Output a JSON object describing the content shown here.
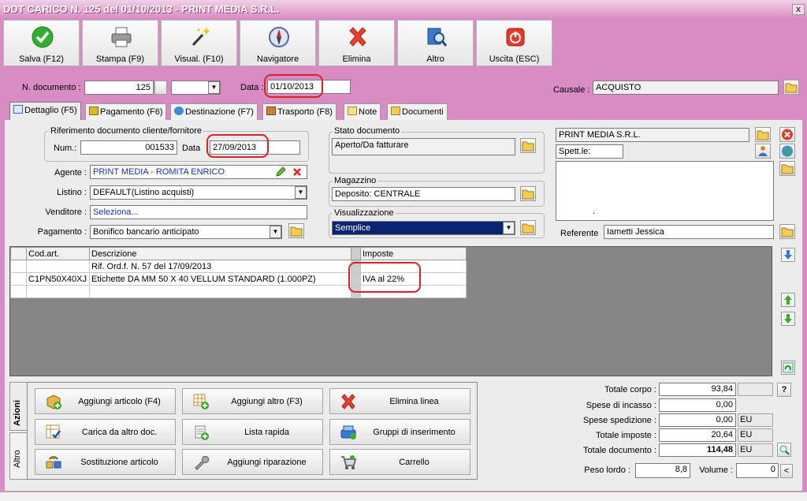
{
  "window": {
    "title": "DDT CARICO N. 125 del 01/10/2013 - PRINT MEDIA S.R.L.",
    "close": "x"
  },
  "toolbar": [
    {
      "label": "Salva (F12)",
      "icon": "check-icon"
    },
    {
      "label": "Stampa (F9)",
      "icon": "printer-icon"
    },
    {
      "label": "Visual. (F10)",
      "icon": "magic-wand-icon"
    },
    {
      "label": "Navigatore",
      "icon": "compass-icon"
    },
    {
      "label": "Elimina",
      "icon": "delete-x-icon"
    },
    {
      "label": "Altro",
      "icon": "search-doc-icon"
    },
    {
      "label": "Uscita (ESC)",
      "icon": "power-icon"
    }
  ],
  "header": {
    "num_doc_label": "N. documento :",
    "num_doc_value": "125",
    "data_label": "Data :",
    "data_value": "01/10/2013",
    "causale_label": "Causale :",
    "causale_value": "ACQUISTO"
  },
  "tabs": [
    {
      "label": "Dettaglio (F5)",
      "active": true
    },
    {
      "label": "Pagamento (F6)"
    },
    {
      "label": "Destinazione (F7)"
    },
    {
      "label": "Trasporto (F8)"
    },
    {
      "label": "Note"
    },
    {
      "label": "Documenti"
    }
  ],
  "riferimento": {
    "title": "Riferimento documento cliente/fornitore",
    "num_label": "Num.:",
    "num_value": "001533",
    "data_label": "Data",
    "data_value": "27/09/2013"
  },
  "form": {
    "agente_label": "Agente :",
    "agente_value": "PRINT MEDIA - ROMITA ENRICO",
    "listino_label": "Listino :",
    "listino_value": "DEFAULT(Listino acquisti)",
    "venditore_label": "Venditore :",
    "venditore_value": "Seleziona...",
    "pagamento_label": "Pagamento :",
    "pagamento_value": "Bonifico bancario anticipato"
  },
  "stato": {
    "title": "Stato documento",
    "value": "Aperto/Da fatturare"
  },
  "magazzino": {
    "title": "Magazzino",
    "value": "Deposito: CENTRALE"
  },
  "visualizzazione": {
    "title": "Visualizzazione",
    "value": "Semplice"
  },
  "fornitore": {
    "name": "PRINT MEDIA S.R.L.",
    "spett_label": "Spett.le:",
    "address_dot": ".",
    "referente_label": "Referente",
    "referente_value": "Iametti Jessica"
  },
  "grid": {
    "headers": [
      "Cod.art.",
      "Descrizione",
      "Imposte"
    ],
    "rows": [
      [
        "",
        "Rif. Ord.f. N. 57 del 17/09/2013",
        ""
      ],
      [
        "C1PN50X40XJ",
        "Etichette DA MM 50 X 40 VELLUM STANDARD (1.000PZ)",
        "IVA al 22%"
      ],
      [
        "",
        "",
        ""
      ]
    ]
  },
  "vtabs": {
    "azioni": "Azioni",
    "altro": "Altro"
  },
  "actions": [
    {
      "label": "Aggiungi articolo (F4)",
      "icon": "add-box-icon"
    },
    {
      "label": "Aggiungi altro (F3)",
      "icon": "add-grid-icon"
    },
    {
      "label": "Elimina linea",
      "icon": "delete-x-icon"
    },
    {
      "label": "Carica da altro doc.",
      "icon": "load-doc-icon"
    },
    {
      "label": "Lista rapida",
      "icon": "quick-list-icon"
    },
    {
      "label": "Gruppi di inserimento",
      "icon": "groups-icon"
    },
    {
      "label": "Sostituzione articolo",
      "icon": "swap-icon"
    },
    {
      "label": "Aggiungi riparazione",
      "icon": "wrench-icon"
    },
    {
      "label": "Carrello",
      "icon": "cart-icon"
    }
  ],
  "totals": {
    "totale_corpo_label": "Totale corpo :",
    "totale_corpo": "93,84",
    "help": "?",
    "spese_incasso_label": "Spese di incasso :",
    "spese_incasso": "0,00",
    "spese_spedizione_label": "Spese spedizione :",
    "spese_spedizione": "0,00",
    "totale_imposte_label": "Totale imposte :",
    "totale_imposte": "20,64",
    "totale_documento_label": "Totale documento :",
    "totale_documento": "114,48",
    "unit": "EU",
    "peso_label": "Peso lordo :",
    "peso": "8,8",
    "volume_label": "Volume :",
    "volume": "0",
    "less": "<"
  }
}
